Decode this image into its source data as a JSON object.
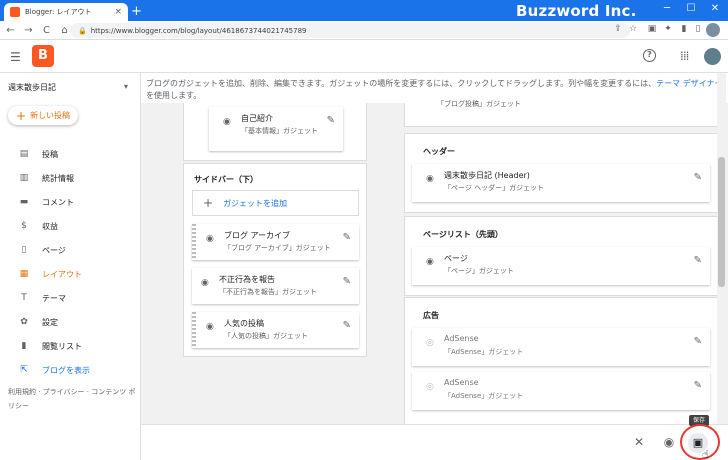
{
  "browser": {
    "tab_title": "Blogger: レイアウト",
    "tab_close": "×",
    "new_tab": "+",
    "brand": "Buzzword Inc.",
    "url": "https://www.blogger.com/blog/layout/4618673744021745789",
    "nav": {
      "back": "←",
      "forward": "→",
      "reload": "C",
      "home": "⌂"
    },
    "window_controls": {
      "minimize": "─",
      "maximize": "☐",
      "close": "✕"
    }
  },
  "header": {
    "logo_letter": "B",
    "help": "?",
    "apps": "⋮⋮⋮"
  },
  "sidebar": {
    "blog_name": "週末散歩日記",
    "dropdown_caret": "▾",
    "new_post_label": "新しい投稿",
    "new_post_plus": "+",
    "items": [
      {
        "label": "投稿",
        "icon": "▤"
      },
      {
        "label": "統計情報",
        "icon": "▥"
      },
      {
        "label": "コメント",
        "icon": "▬"
      },
      {
        "label": "収益",
        "icon": "$"
      },
      {
        "label": "ページ",
        "icon": "▯"
      },
      {
        "label": "レイアウト",
        "icon": "▦"
      },
      {
        "label": "テーマ",
        "icon": "T"
      },
      {
        "label": "設定",
        "icon": "✿"
      },
      {
        "label": "閲覧リスト",
        "icon": "▮"
      }
    ],
    "view_blog": {
      "label": "ブログを表示",
      "icon": "⇱"
    },
    "footer": "利用規約 · プライバシー · コンテンツ ポリシー"
  },
  "main": {
    "info_text": "ブログのガジェットを追加、削除、編集できます。ガジェットの場所を変更するには、クリックしてドラッグします。列や幅を変更するには、",
    "info_link": "テーマ デザイナ",
    "info_suffix": "ーを使用します。",
    "top_gadget": {
      "name": "自己紹介",
      "type": "「基本情報」ガジェット"
    },
    "partial_top_right": "「ブログ投稿」ガジェット",
    "sidebar_panel": {
      "title": "サイドバー（下）",
      "add_label": "ガジェットを追加",
      "gadgets": [
        {
          "name": "ブログ アーカイブ",
          "type": "「ブログ アーカイブ」ガジェット",
          "visible": true,
          "grip": true
        },
        {
          "name": "不正行為を報告",
          "type": "「不正行為を報告」ガジェット",
          "visible": true,
          "grip": false
        },
        {
          "name": "人気の投稿",
          "type": "「人気の投稿」ガジェット",
          "visible": true,
          "grip": true
        }
      ]
    },
    "header_panel": {
      "title": "ヘッダー",
      "gadget": {
        "name": "週末散歩日記 (Header)",
        "type": "「ページ ヘッダー」ガジェット"
      }
    },
    "pagelist_panel": {
      "title": "ページリスト（先頭）",
      "gadget": {
        "name": "ページ",
        "type": "「ページ」ガジェット"
      }
    },
    "ads_panel": {
      "title": "広告",
      "gadgets": [
        {
          "name": "AdSense",
          "type": "「AdSense」ガジェット",
          "visible": false
        },
        {
          "name": "AdSense",
          "type": "「AdSense」ガジェット",
          "visible": false
        }
      ]
    }
  },
  "action_bar": {
    "close": "✕",
    "preview": "◉",
    "save": "▣",
    "save_tooltip": "保存"
  },
  "icons": {
    "eye": "◉",
    "eye_off": "◎",
    "pencil": "✎",
    "plus": "+"
  }
}
